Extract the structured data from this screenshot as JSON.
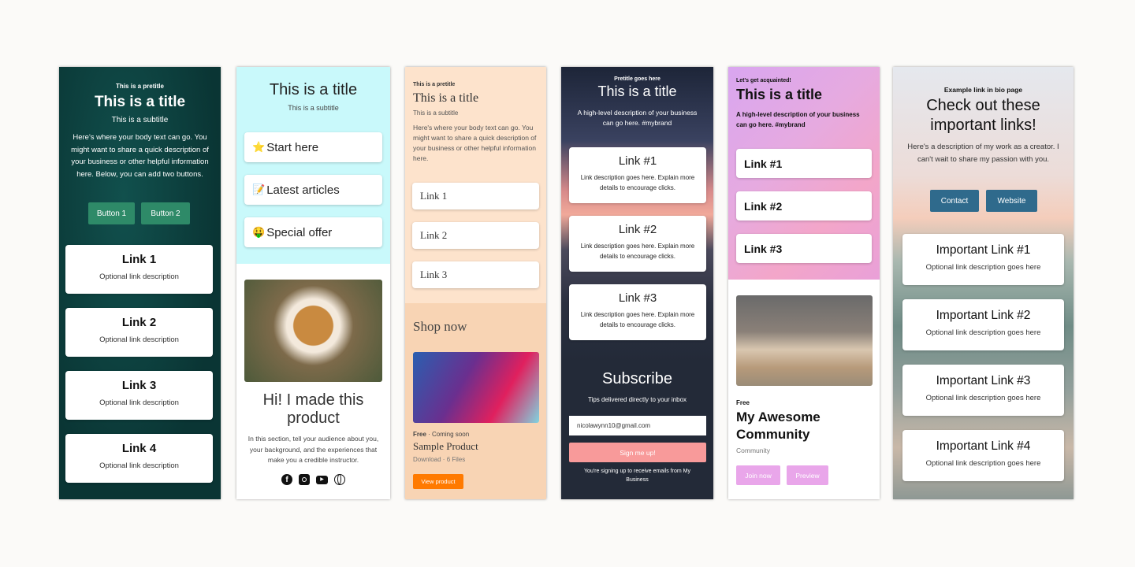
{
  "card1": {
    "pretitle": "This is a pretitle",
    "title": "This is a title",
    "subtitle": "This is a subtitle",
    "body": "Here's where your body text can go. You might want to share a quick description of your business or other helpful information here. Below, you can add two buttons.",
    "buttons": [
      "Button 1",
      "Button 2"
    ],
    "links": [
      {
        "title": "Link 1",
        "desc": "Optional link description"
      },
      {
        "title": "Link 2",
        "desc": "Optional link description"
      },
      {
        "title": "Link 3",
        "desc": "Optional link description"
      },
      {
        "title": "Link 4",
        "desc": "Optional link description"
      }
    ],
    "colors": {
      "bg": "#0b3b3a",
      "button": "#2e8a68"
    }
  },
  "card2": {
    "title": "This is a title",
    "subtitle": "This is a subtitle",
    "links": [
      {
        "emoji": "⭐",
        "label": "Start here"
      },
      {
        "emoji": "📝",
        "label": "Latest articles"
      },
      {
        "emoji": "🤑",
        "label": "Special offer"
      }
    ],
    "heading": "Hi! I made this product",
    "body": "In this section, tell your audience about you, your background, and the experiences that make you a credible instructor.",
    "social_icons": [
      "facebook-icon",
      "instagram-icon",
      "youtube-icon",
      "globe-icon"
    ],
    "colors": {
      "top": "#c9f9fb"
    }
  },
  "card3": {
    "pretitle": "This is a pretitle",
    "title": "This is a title",
    "subtitle": "This is a subtitle",
    "body": "Here's where your body text can go. You might want to share a quick description of your business or other helpful information here.",
    "links": [
      "Link 1",
      "Link 2",
      "Link 3"
    ],
    "shop_heading": "Shop now",
    "product": {
      "price": "Free",
      "status": "Coming soon",
      "name": "Sample Product",
      "type": "Download",
      "files": "6 Files",
      "button": "View product"
    },
    "colors": {
      "top": "#fde3cc",
      "bottom": "#f8d4b4",
      "button": "#ff7a00"
    }
  },
  "card4": {
    "pretitle": "Pretitle goes here",
    "title": "This is a title",
    "body": "A high-level description of your business can go here. #mybrand",
    "links": [
      {
        "title": "Link #1",
        "desc": "Link description goes here. Explain more details to encourage clicks."
      },
      {
        "title": "Link #2",
        "desc": "Link description goes here. Explain more details to encourage clicks."
      },
      {
        "title": "Link #3",
        "desc": "Link description goes here. Explain more details to encourage clicks."
      }
    ],
    "subscribe": {
      "title": "Subscribe",
      "subtitle": "Tips delivered directly to your inbox",
      "email": "nicolawynn10@gmail.com",
      "button": "Sign me up!",
      "note": "You're signing up to receive emails from My Business"
    },
    "colors": {
      "bg": "#232a38",
      "button": "#f89a9a"
    }
  },
  "card5": {
    "pretitle": "Let's get acquainted!",
    "title": "This is a title",
    "body": "A high-level description of your business can go here. #mybrand",
    "links": [
      "Link #1",
      "Link #2",
      "Link #3"
    ],
    "community": {
      "price": "Free",
      "name": "My Awesome Community",
      "type": "Community",
      "buttons": [
        "Join now",
        "Preview"
      ]
    },
    "colors": {
      "button": "#e9a6ea"
    }
  },
  "card6": {
    "pretitle": "Example link in bio page",
    "title": "Check out these important links!",
    "body": "Here's a description of my work as a creator. I can't wait to share my passion with you.",
    "buttons": [
      "Contact",
      "Website"
    ],
    "links": [
      {
        "title": "Important Link #1",
        "desc": "Optional link description goes here"
      },
      {
        "title": "Important Link #2",
        "desc": "Optional link description goes here"
      },
      {
        "title": "Important Link #3",
        "desc": "Optional link description goes here"
      },
      {
        "title": "Important Link #4",
        "desc": "Optional link description goes here"
      }
    ],
    "colors": {
      "button": "#2f6a8c"
    }
  }
}
